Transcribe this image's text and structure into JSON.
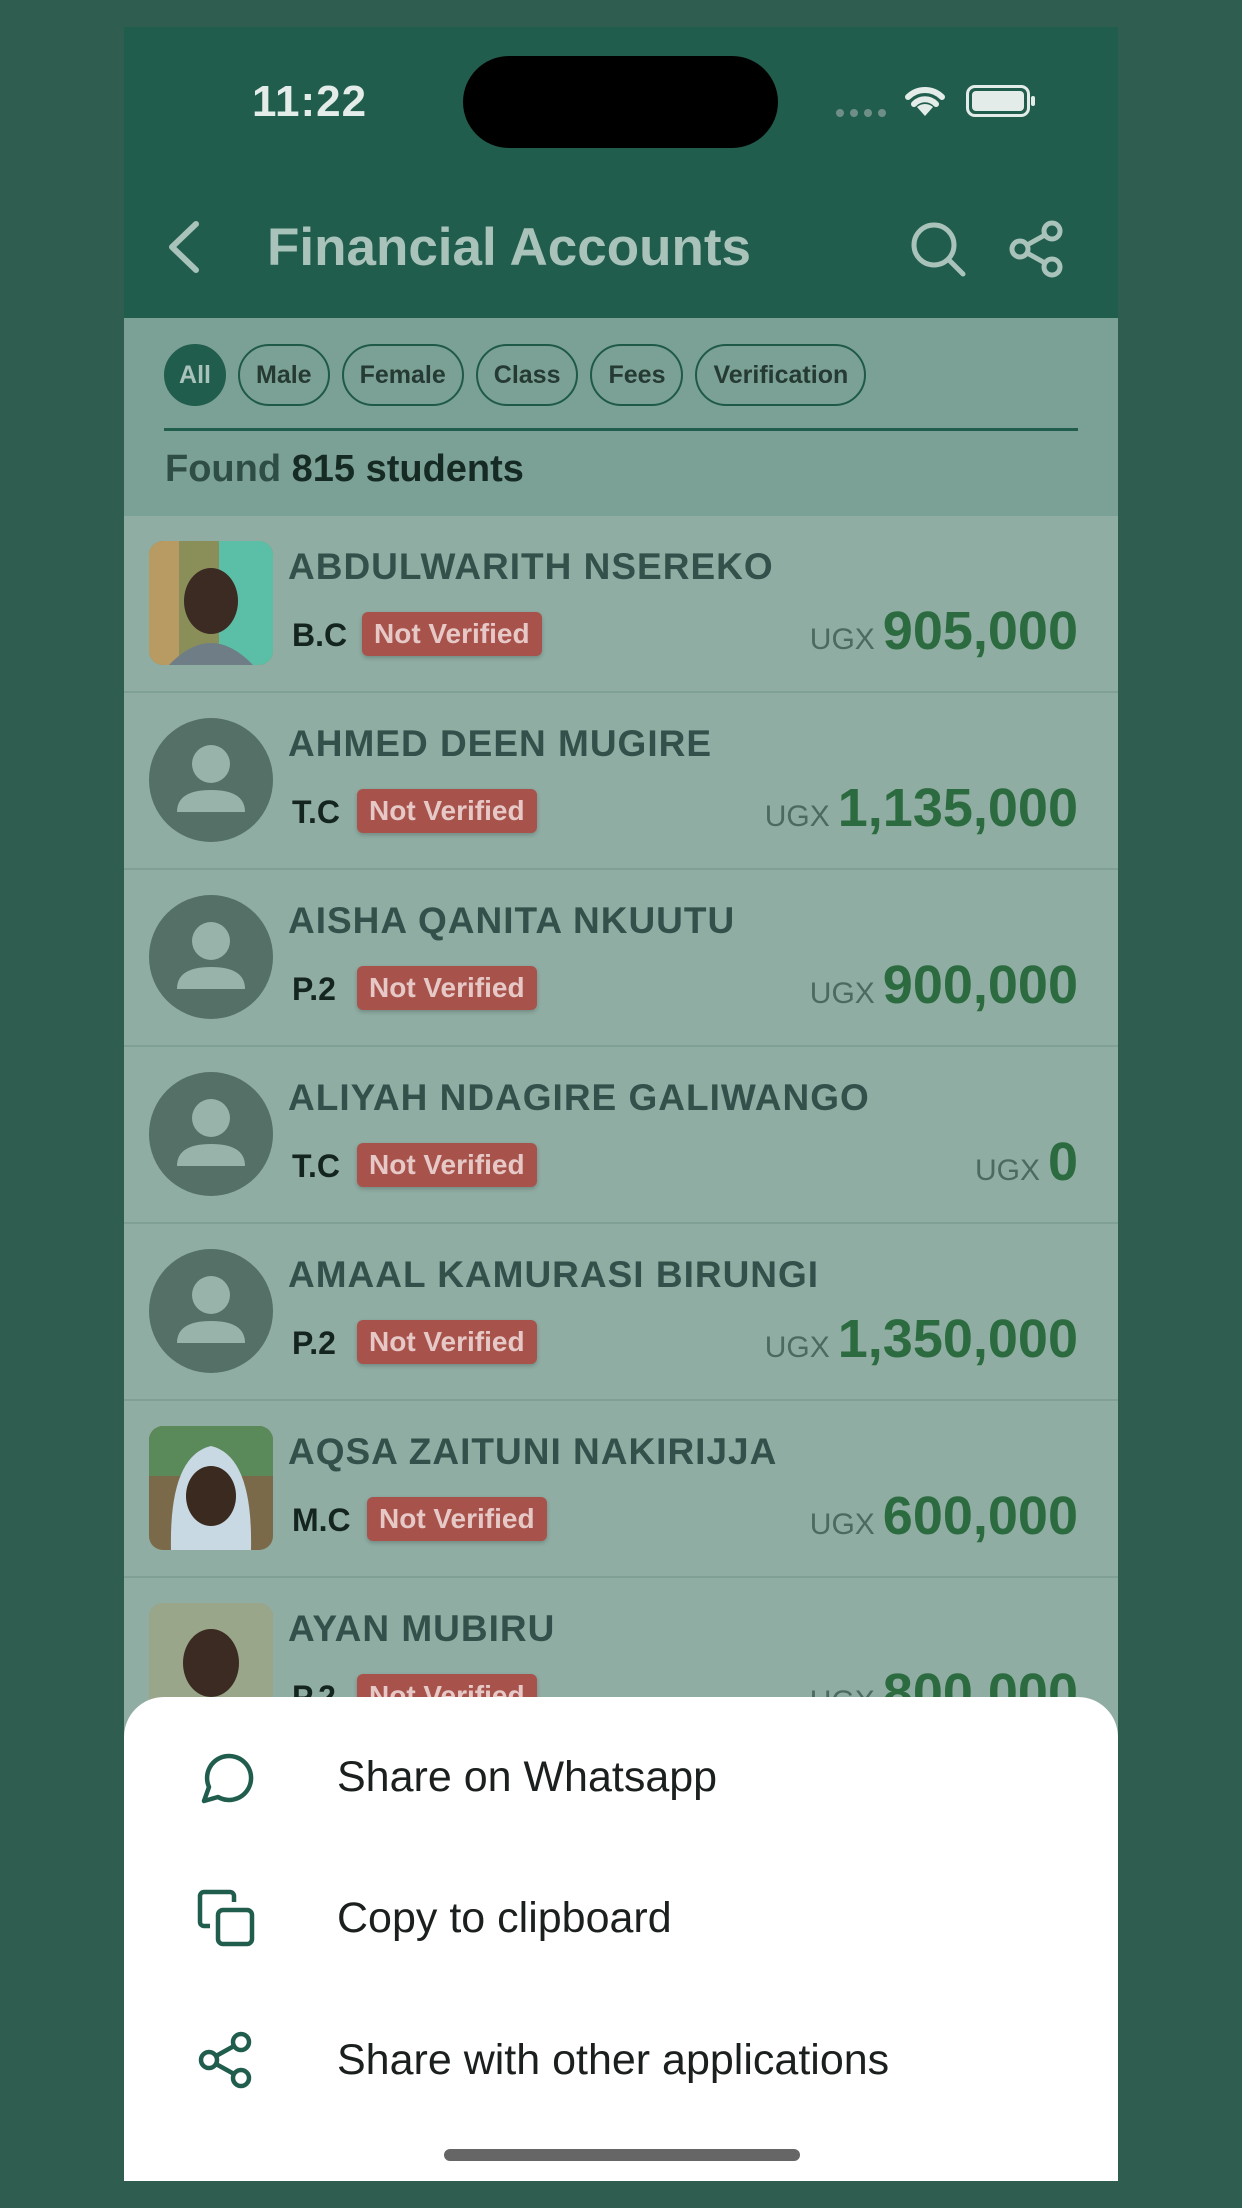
{
  "status_bar": {
    "time": "11:22"
  },
  "header": {
    "title": "Financial Accounts",
    "back_icon": "chevron-left-icon",
    "search_icon": "search-icon",
    "share_icon": "share-icon"
  },
  "filters": {
    "chips": [
      "All",
      "Male",
      "Female",
      "Class",
      "Fees",
      "Verification"
    ],
    "active": "All"
  },
  "summary": {
    "prefix": "Found",
    "count_text": "815 students"
  },
  "students": [
    {
      "name": "ABDULWARITH NSEREKO",
      "class": "B.C",
      "status": "Not Verified",
      "currency": "UGX",
      "amount": "905,000",
      "avatar": "photo"
    },
    {
      "name": "AHMED DEEN MUGIRE",
      "class": "T.C",
      "status": "Not Verified",
      "currency": "UGX",
      "amount": "1,135,000",
      "avatar": "placeholder"
    },
    {
      "name": "AISHA QANITA NKUUTU",
      "class": "P.2",
      "status": "Not Verified",
      "currency": "UGX",
      "amount": "900,000",
      "avatar": "placeholder"
    },
    {
      "name": "ALIYAH NDAGIRE GALIWANGO",
      "class": "T.C",
      "status": "Not Verified",
      "currency": "UGX",
      "amount": "0",
      "avatar": "placeholder"
    },
    {
      "name": "AMAAL KAMURASI BIRUNGI",
      "class": "P.2",
      "status": "Not Verified",
      "currency": "UGX",
      "amount": "1,350,000",
      "avatar": "placeholder"
    },
    {
      "name": "AQSA ZAITUNI NAKIRIJJA",
      "class": "M.C",
      "status": "Not Verified",
      "currency": "UGX",
      "amount": "600,000",
      "avatar": "photo"
    },
    {
      "name": "AYAN MUBIRU",
      "class": "P.2",
      "status": "Not Verified",
      "currency": "UGX",
      "amount": "800,000",
      "avatar": "photo"
    }
  ],
  "share_sheet": {
    "options": [
      {
        "label": "Share on Whatsapp",
        "icon": "chat-bubble-icon"
      },
      {
        "label": "Copy to clipboard",
        "icon": "copy-icon"
      },
      {
        "label": "Share with other applications",
        "icon": "share-icon"
      }
    ]
  },
  "colors": {
    "primary": "#215d4d",
    "badge": "#a8524c",
    "amount": "#2c6b3f",
    "background": "#2f5d4f"
  }
}
